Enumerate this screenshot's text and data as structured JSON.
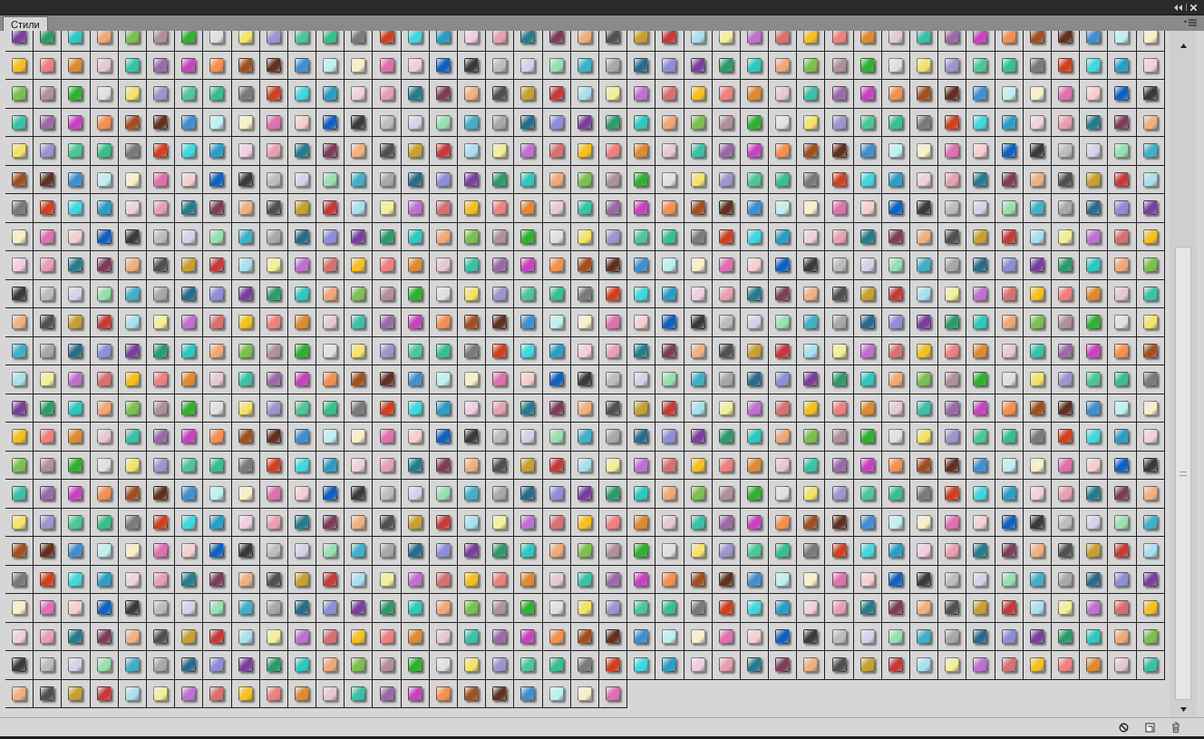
{
  "panel": {
    "tabs": [
      {
        "label": "Стили",
        "selected": true
      }
    ]
  }
}
